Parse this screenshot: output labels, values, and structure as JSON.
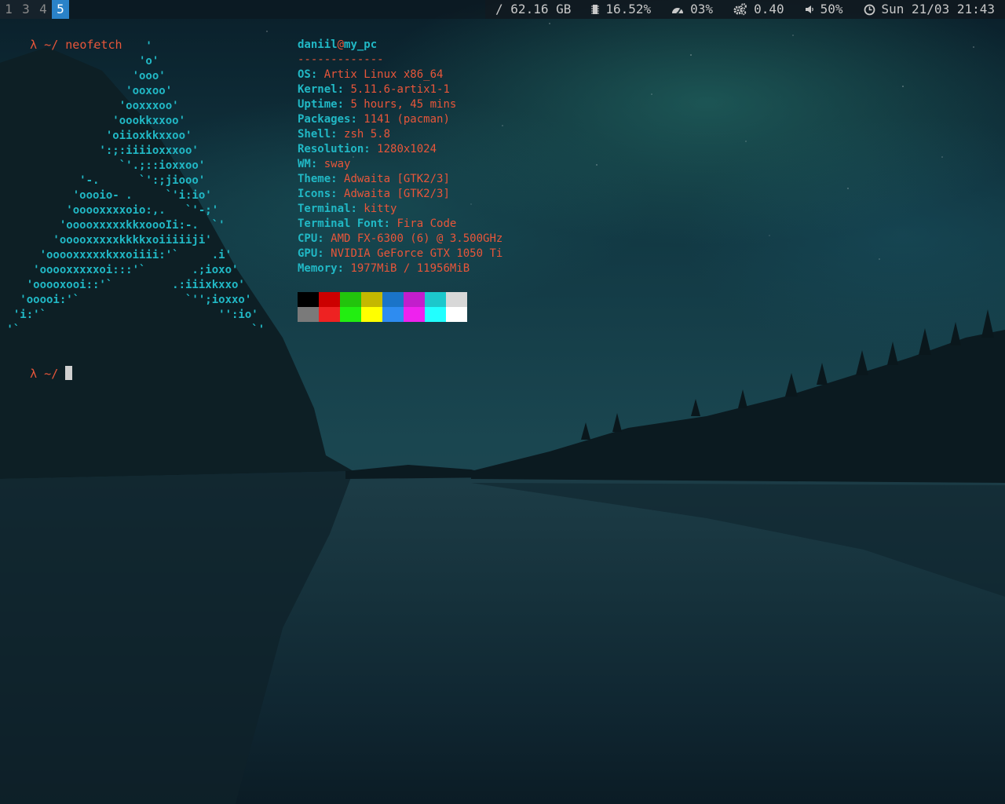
{
  "bar": {
    "workspaces": [
      {
        "label": "1",
        "focused": false
      },
      {
        "label": "3",
        "focused": false
      },
      {
        "label": "4",
        "focused": false
      },
      {
        "label": "5",
        "focused": true
      }
    ],
    "disk": "/ 62.16 GB",
    "memory": "16.52%",
    "cpu": "03%",
    "load": "0.40",
    "volume": "50%",
    "datetime": "Sun 21/03 21:43",
    "icons": [
      "memory-chip-icon",
      "speedometer-icon",
      "gears-icon",
      "speaker-icon",
      "clock-icon"
    ]
  },
  "terminal": {
    "prompt1": "λ ~/ neofetch",
    "prompt2": "λ ~/ ",
    "ascii_art": "                      '\n                     'o'\n                    'ooo'\n                   'ooxoo'\n                  'ooxxxoo'\n                 'oookkxxoo'\n                'oiioxkkxxoo'\n               ':;:iiiioxxxoo'\n                  `'.;::ioxxoo'\n            '-.      `':;jiooo'\n           'oooio- .     `'i:io'\n          'ooooxxxxoio:,.   `'-;'\n         'ooooxxxxxkkxoooIi:-.  `'\n        'ooooxxxxxkkkkxoiiiiiji'\n      'ooooxxxxxkxxoiiii:'`     .i'\n     'ooooxxxxxoi:::'`       .;ioxo'\n    'ooooxooi::'`         .:iiixkxxo'\n   'ooooi:'`                `'';ioxxo'\n  'i:'`                          '':io'\n '`                                   `'",
    "neofetch": {
      "user": "daniil",
      "at": "@",
      "host": "my_pc",
      "separator": "-------------",
      "fields": [
        {
          "key": "OS",
          "value": "Artix Linux x86_64"
        },
        {
          "key": "Kernel",
          "value": "5.11.6-artix1-1"
        },
        {
          "key": "Uptime",
          "value": "5 hours, 45 mins"
        },
        {
          "key": "Packages",
          "value": "1141 (pacman)"
        },
        {
          "key": "Shell",
          "value": "zsh 5.8"
        },
        {
          "key": "Resolution",
          "value": "1280x1024"
        },
        {
          "key": "WM",
          "value": "sway"
        },
        {
          "key": "Theme",
          "value": "Adwaita [GTK2/3]"
        },
        {
          "key": "Icons",
          "value": "Adwaita [GTK2/3]"
        },
        {
          "key": "Terminal",
          "value": "kitty"
        },
        {
          "key": "Terminal Font",
          "value": "Fira Code"
        },
        {
          "key": "CPU",
          "value": "AMD FX-6300 (6) @ 3.500GHz"
        },
        {
          "key": "GPU",
          "value": "NVIDIA GeForce GTX 1050 Ti"
        },
        {
          "key": "Memory",
          "value": "1977MiB / 11956MiB"
        }
      ],
      "palette": [
        [
          "#000000",
          "#cc0000",
          "#22c40c",
          "#c4b800",
          "#1a74c8",
          "#c21ecc",
          "#1cc8cc",
          "#d8d8d8"
        ],
        [
          "#7a7a7a",
          "#ee2222",
          "#22ee11",
          "#ffff00",
          "#2e8cf0",
          "#ee22ee",
          "#22ffff",
          "#ffffff"
        ]
      ]
    }
  }
}
